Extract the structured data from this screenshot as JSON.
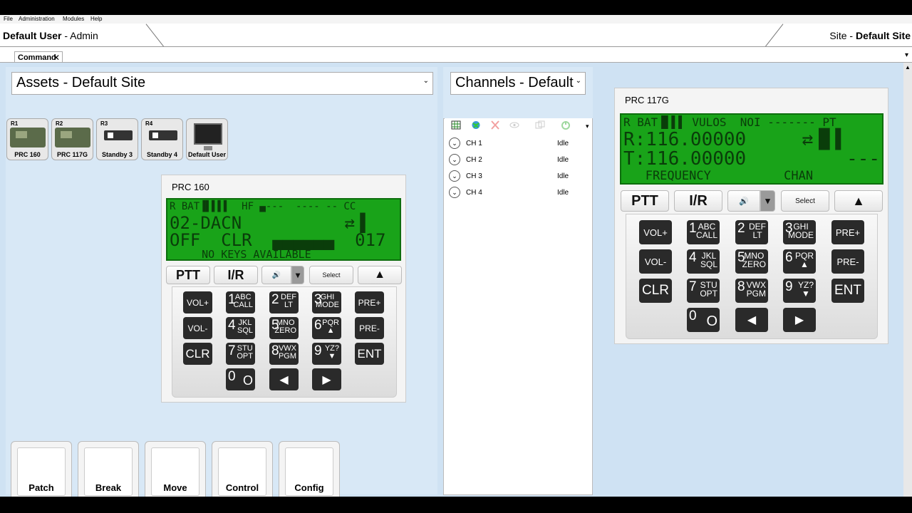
{
  "menu": [
    "File",
    "Administration",
    "Modules",
    "Help"
  ],
  "header": {
    "user": "Default User",
    "role": "- Admin",
    "site_prefix": "Site - ",
    "site": "Default Site"
  },
  "tab": {
    "label": "Command",
    "close": "✕",
    "menu": "▾"
  },
  "assets": {
    "dropdown": "Assets - Default Site",
    "items": [
      {
        "tag": "R1",
        "label": "PRC 160",
        "icon": "radio-icon"
      },
      {
        "tag": "R2",
        "label": "PRC 117G",
        "icon": "radio-icon"
      },
      {
        "tag": "R3",
        "label": "Standby 3",
        "icon": "standby-radio-icon"
      },
      {
        "tag": "R4",
        "label": "Standby 4",
        "icon": "standby-radio-icon"
      },
      {
        "tag": "",
        "label": "Default User",
        "icon": "monitor-icon"
      }
    ]
  },
  "radio1": {
    "title": "PRC 160",
    "lcd": [
      "R BAT▐▌▌▌▌  HF ▄---  ---- -- CC",
      "02-DACN          ⇄▐     ▌",
      "OFF  CLR  ▄▄▄▄▄▄  017",
      "     NO KEYS AVAILABLE"
    ]
  },
  "radio2": {
    "title": "PRC 117G",
    "lcd": [
      "R BAT▐▌▌▌ VULOS  NOI ------- PT",
      "R:116.00000     ⇄▐▌▌    ▌",
      "T:116.00000         ---",
      "   FREQUENCY          CHAN"
    ]
  },
  "controls": {
    "ptt": "PTT",
    "ir": "I/R",
    "volume": "🔊",
    "dropdown": "▾",
    "select": "Select",
    "up": "▲"
  },
  "keys": {
    "vol_up": "VOL+",
    "vol_down": "VOL-",
    "clr": "CLR",
    "pre_up": "PRE+",
    "pre_down": "PRE-",
    "ent": "ENT",
    "k1": {
      "n": "1",
      "s": "ABC\nCALL"
    },
    "k2": {
      "n": "2",
      "s": "DEF\nLT"
    },
    "k3": {
      "n": "3",
      "s": "GHI\nMODE"
    },
    "k4": {
      "n": "4",
      "s": "JKL\nSQL"
    },
    "k5": {
      "n": "5",
      "s": "MNO\nZERO"
    },
    "k6": {
      "n": "6",
      "s": "PQR\n▲"
    },
    "k7": {
      "n": "7",
      "s": "STU\nOPT"
    },
    "k8": {
      "n": "8",
      "s": "VWX\nPGM"
    },
    "k9": {
      "n": "9",
      "s": "YZ?\n▼"
    },
    "k0": {
      "n": "0",
      "s": "O"
    },
    "left": "◀",
    "right": "▶"
  },
  "actions": [
    "Patch",
    "Break",
    "Move",
    "Control",
    "Config"
  ],
  "channels": {
    "dropdown": "Channels - Default",
    "toolbar_icons": [
      "grid-icon",
      "globe-icon",
      "delete-icon",
      "eye-icon",
      "copy-icon",
      "power-icon"
    ],
    "items": [
      {
        "name": "CH 1",
        "status": "Idle"
      },
      {
        "name": "CH 2",
        "status": "Idle"
      },
      {
        "name": "CH 3",
        "status": "Idle"
      },
      {
        "name": "CH 4",
        "status": "Idle"
      }
    ],
    "overflow": "▾"
  }
}
